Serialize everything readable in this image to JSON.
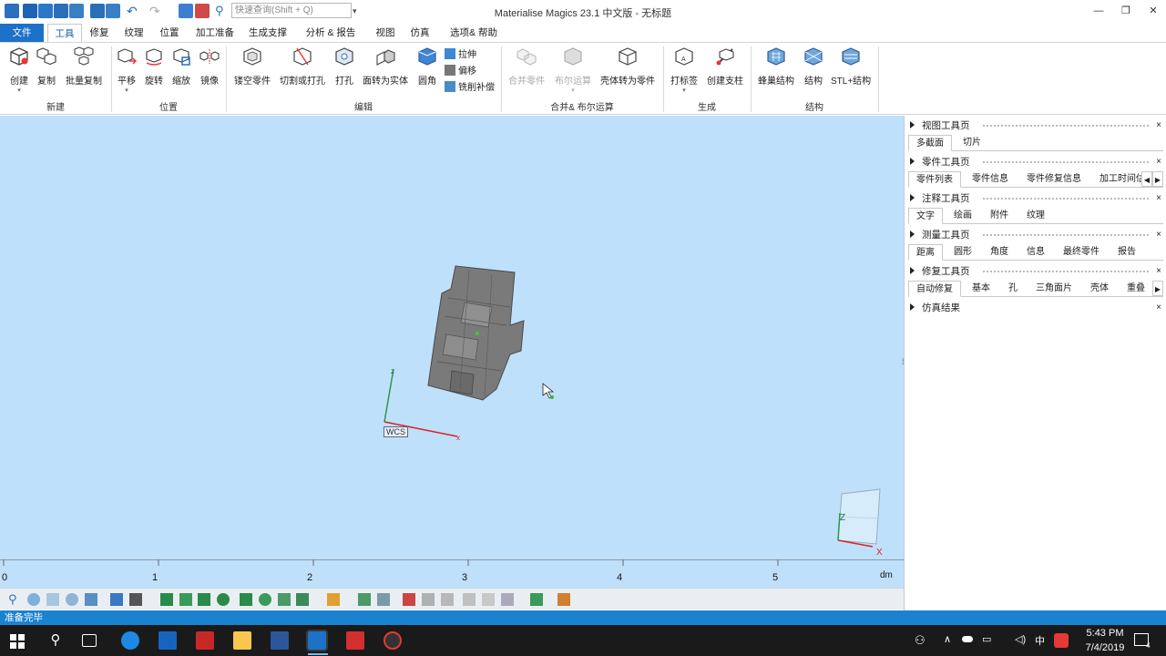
{
  "app": {
    "title": "Materialise Magics 23.1 中文版 - 无标题",
    "search_placeholder": "快速查询(Shift + Q)"
  },
  "menu": {
    "tabs": [
      "文件",
      "工具",
      "修复",
      "纹理",
      "位置",
      "加工准备",
      "生成支撑",
      "分析 & 报告",
      "视图",
      "仿真",
      "选项& 帮助"
    ],
    "active": "工具"
  },
  "ribbon": {
    "new": {
      "label": "新建",
      "buttons": [
        "创建",
        "复制",
        "批量复制"
      ]
    },
    "position": {
      "label": "位置",
      "buttons": [
        "平移",
        "旋转",
        "缩放",
        "镜像"
      ]
    },
    "edit": {
      "label": "编辑",
      "buttons": [
        "镂空零件",
        "切割或打孔",
        "打孔",
        "面转为实体",
        "圆角"
      ],
      "small": [
        "拉伸",
        "偏移",
        "铣削补偿"
      ]
    },
    "boolean": {
      "label": "合并& 布尔运算",
      "buttons": [
        "合并零件",
        "布尔运算",
        "壳体转为零件"
      ]
    },
    "generate": {
      "label": "生成",
      "buttons": [
        "打标签",
        "创建支柱"
      ]
    },
    "structure": {
      "label": "结构",
      "buttons": [
        "蜂巢结构",
        "结构",
        "STL+结构"
      ]
    }
  },
  "viewport": {
    "wcs_label": "WCS",
    "axis_z": "z",
    "axis_x": "x",
    "cube_z": "Z",
    "cube_x": "X",
    "ruler_unit": "dm",
    "ruler_ticks": [
      "0",
      "1",
      "2",
      "3",
      "4",
      "5"
    ]
  },
  "status": {
    "text": "准备完毕"
  },
  "panel": {
    "view_toolpage": {
      "title": "视图工具页",
      "tabs": [
        "多截面",
        "切片"
      ]
    },
    "part_toolpage": {
      "title": "零件工具页",
      "tabs": [
        "零件列表",
        "零件信息",
        "零件修复信息",
        "加工时间估"
      ]
    },
    "annotation_toolpage": {
      "title": "注释工具页",
      "tabs": [
        "文字",
        "绘画",
        "附件",
        "纹理"
      ]
    },
    "measure_toolpage": {
      "title": "测量工具页",
      "tabs": [
        "距离",
        "圆形",
        "角度",
        "信息",
        "最终零件",
        "报告"
      ]
    },
    "repair_toolpage": {
      "title": "修复工具页",
      "tabs": [
        "自动修复",
        "基本",
        "孔",
        "三角面片",
        "壳体",
        "重叠"
      ]
    },
    "sim_results": {
      "title": "仿真结果"
    }
  },
  "taskbar": {
    "time": "5:43 PM",
    "date": "7/4/2019",
    "ime": "中",
    "notif_count": "4"
  },
  "colors": {
    "accent": "#1c72c7",
    "viewport_bg": "#bfe0fb",
    "status_bar": "#1b82d0",
    "part_gray": "#7a7a7a",
    "axis_x": "#d22",
    "axis_z": "#2a9a4a"
  }
}
